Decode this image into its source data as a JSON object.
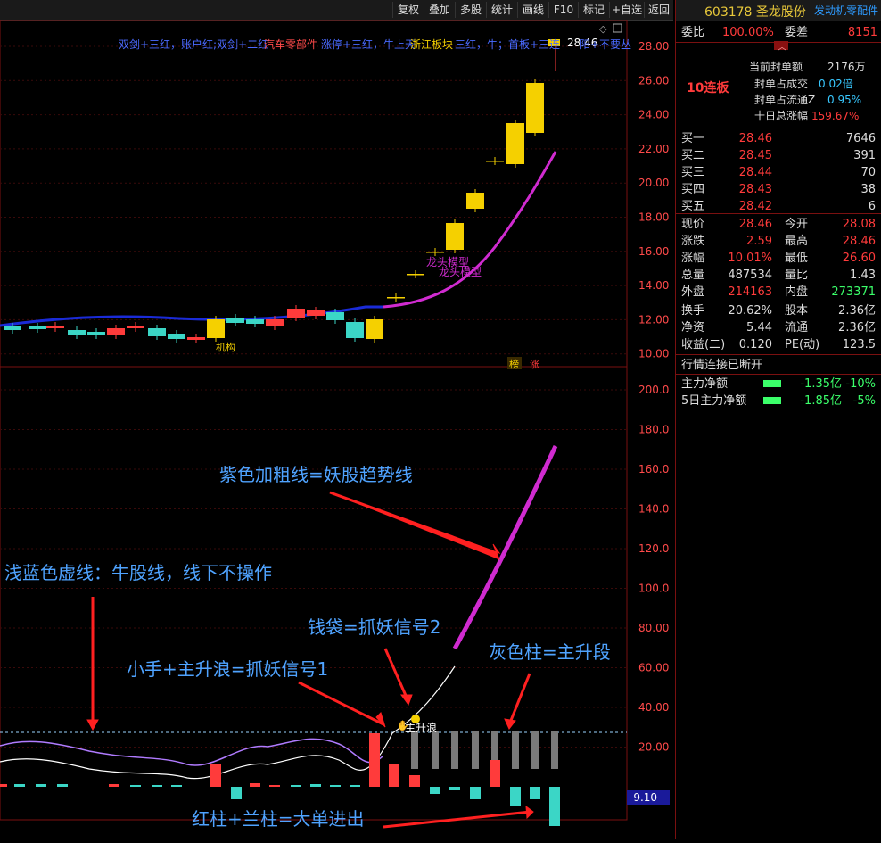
{
  "toolbar": [
    "复权",
    "叠加",
    "多股",
    "统计",
    "画线",
    "F10",
    "标记",
    "+自选",
    "返回"
  ],
  "header_indicators": {
    "text": "双剑+三红，账户红;双剑+二红",
    "overlay_red": "汽车零部件",
    "text2": "涨停+三红，牛上天",
    "overlay_yellow": "浙江板块",
    "text3": "三红，牛；首板+三连",
    "text4": "阳+不要丛"
  },
  "price_labels": {
    "last_price": "28.46",
    "dragon_model_1": "龙头模型",
    "dragon_model_2": "龙头模型",
    "institution": "机构",
    "bang": "榜",
    "zhang": "涨"
  },
  "price_axis": [
    "28.00",
    "26.00",
    "24.00",
    "22.00",
    "20.00",
    "18.00",
    "16.00",
    "14.00",
    "12.00",
    "10.00"
  ],
  "indicator_axis": [
    "200.0",
    "180.0",
    "160.0",
    "140.0",
    "120.0",
    "100.0",
    "80.00",
    "60.00",
    "40.00",
    "20.00"
  ],
  "indicator_current": "-9.10",
  "indicator_tag": "主升浪",
  "annotations": {
    "purple_line": "紫色加粗线=妖股趋势线",
    "light_blue": "浅蓝色虚线：牛股线，线下不操作",
    "money_bag": "钱袋=抓妖信号2",
    "hand_signal": "小手+主升浪=抓妖信号1",
    "gray_bar": "灰色柱=主升段",
    "red_blue_bar": "红柱+兰柱=大单进出"
  },
  "quote": {
    "code_name": "603178 圣龙股份",
    "concept": "发动机零配件",
    "weibi_label": "委比",
    "weibi_value": "100.00%",
    "weicha_label": "委差",
    "weicha_value": "8151",
    "limit_badge": "10连板",
    "seal_amount_label": "当前封单额",
    "seal_amount_value": "2176万",
    "seal_deal_label": "封单占成交",
    "seal_deal_value": "0.02倍",
    "seal_float_label": "封单占流通Z",
    "seal_float_value": "0.95%",
    "ten_day_label": "十日总涨幅",
    "ten_day_value": "159.67%",
    "bids": [
      {
        "label": "买一",
        "price": "28.46",
        "vol": "7646"
      },
      {
        "label": "买二",
        "price": "28.45",
        "vol": "391"
      },
      {
        "label": "买三",
        "price": "28.44",
        "vol": "70"
      },
      {
        "label": "买四",
        "price": "28.43",
        "vol": "38"
      },
      {
        "label": "买五",
        "price": "28.42",
        "vol": "6"
      }
    ],
    "stats": [
      {
        "l1": "现价",
        "v1": "28.46",
        "l2": "今开",
        "v2": "28.08"
      },
      {
        "l1": "涨跌",
        "v1": "2.59",
        "l2": "最高",
        "v2": "28.46"
      },
      {
        "l1": "涨幅",
        "v1": "10.01%",
        "l2": "最低",
        "v2": "26.60"
      },
      {
        "l1": "总量",
        "v1": "487534",
        "l2": "量比",
        "v2": "1.43"
      },
      {
        "l1": "外盘",
        "v1": "214163",
        "l2": "内盘",
        "v2": "273371"
      }
    ],
    "stats2": [
      {
        "l1": "换手",
        "v1": "20.62%",
        "l2": "股本",
        "v2": "2.36亿"
      },
      {
        "l1": "净资",
        "v1": "5.44",
        "l2": "流通",
        "v2": "2.36亿"
      },
      {
        "l1": "收益(二)",
        "v1": "0.120",
        "l2": "PE(动)",
        "v2": "123.5"
      }
    ],
    "connection": "行情连接已断开",
    "flow": [
      {
        "label": "主力净额",
        "value": "-1.35亿",
        "pct": "-10%"
      },
      {
        "label": "5日主力净额",
        "value": "-1.85亿",
        "pct": "-5%"
      }
    ]
  },
  "colors": {
    "up": "#ff3b3b",
    "down": "#3bd6c6",
    "limit": "#f5d000",
    "trend": "#d02bd0",
    "ma": "#1a2bd8"
  }
}
